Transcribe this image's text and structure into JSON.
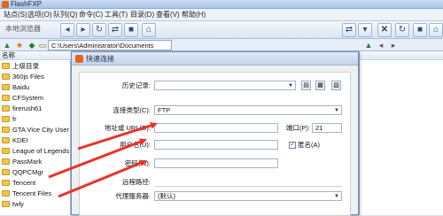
{
  "window": {
    "title": "FlashFXP"
  },
  "menubar": {
    "items": [
      "站点(S)",
      "选项(O)",
      "队列(Q)",
      "命令(C)",
      "工具(T)",
      "目录(D)",
      "查看(V)",
      "帮助(H)"
    ]
  },
  "toolbar": {
    "local_label": "本地浏览器"
  },
  "addressbar": {
    "path": "C:\\Users\\Administrator\\Documents"
  },
  "left_panel": {
    "column_header": "名称",
    "items": [
      "上级目录",
      "360js Files",
      "Baidu",
      "CFSystem",
      "firerush61",
      "fr",
      "GTA Vice City User File",
      "KDEI",
      "League of Legends",
      "PassMark",
      "QQPCMgr",
      "Tencent",
      "Tencent Files",
      "twly"
    ]
  },
  "dialog": {
    "title": "快速连接",
    "history_label": "历史记录:",
    "history_value": "",
    "connection_type_label": "连接类型(C):",
    "connection_type_value": "FTP",
    "address_label": "地址或 URL(D):",
    "address_value": "",
    "port_label": "端口(P):",
    "port_value": "21",
    "username_label": "用户名(U):",
    "username_value": "",
    "anonymous_label": "匿名(A)",
    "password_label": "密码(W):",
    "password_value": "",
    "remote_path_label": "远程路径:",
    "remote_path_value": "",
    "proxy_label": "代理服务器:",
    "proxy_value": "(默认)"
  },
  "annotation": {
    "color": "#e8332b"
  }
}
